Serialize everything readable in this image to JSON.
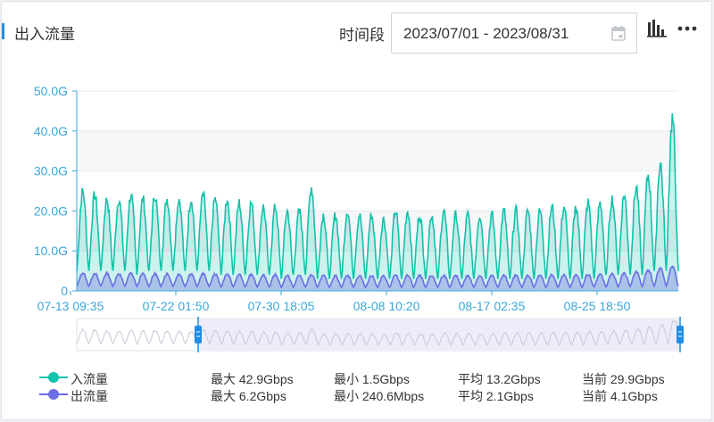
{
  "header": {
    "title": "出入流量",
    "range_label": "时间段",
    "date_range": "2023/07/01 - 2023/08/31"
  },
  "icons": {
    "calendar": "calendar-icon",
    "chart_toggle": "bar-chart-icon",
    "more": "more-dots-icon"
  },
  "colors": {
    "accent": "#1e8ee6",
    "inbound": "#12c2aa",
    "outbound": "#6c6de4",
    "axis": "#3ba7d9",
    "slider_handle": "#1e8ee6"
  },
  "chart_data": {
    "type": "area",
    "y_unit": "Gbps",
    "ylim": [
      0,
      50
    ],
    "y_ticks": [
      "0",
      "10.0G",
      "20.0G",
      "30.0G",
      "40.0G",
      "50.0G"
    ],
    "x_tick_labels": [
      "07-13 09:35",
      "07-22 01:50",
      "07-30 18:05",
      "08-08 10:20",
      "08-17 02:35",
      "08-25 18:50"
    ],
    "grid": true,
    "x_start": "07-13 00:00",
    "x_end": "08-31 24:00",
    "daily": {
      "dates": [
        "07-13",
        "07-14",
        "07-15",
        "07-16",
        "07-17",
        "07-18",
        "07-19",
        "07-20",
        "07-21",
        "07-22",
        "07-23",
        "07-24",
        "07-25",
        "07-26",
        "07-27",
        "07-28",
        "07-29",
        "07-30",
        "07-31",
        "08-01",
        "08-02",
        "08-03",
        "08-04",
        "08-05",
        "08-06",
        "08-07",
        "08-08",
        "08-09",
        "08-10",
        "08-11",
        "08-12",
        "08-13",
        "08-14",
        "08-15",
        "08-16",
        "08-17",
        "08-18",
        "08-19",
        "08-20",
        "08-21",
        "08-22",
        "08-23",
        "08-24",
        "08-25",
        "08-26",
        "08-27",
        "08-28",
        "08-29",
        "08-30",
        "08-31"
      ],
      "in_peak": [
        25,
        24,
        23,
        23,
        24,
        23,
        24,
        23,
        23,
        23,
        24,
        23,
        23,
        22,
        22,
        21,
        21,
        20,
        20,
        26,
        19,
        19,
        20,
        19,
        19,
        18,
        20,
        20,
        19,
        19,
        20,
        19,
        19,
        19,
        19,
        20,
        20,
        20,
        20,
        21,
        21,
        21,
        22,
        22,
        23,
        24,
        26,
        29,
        32,
        43
      ],
      "in_low": [
        5,
        5,
        5,
        5,
        5,
        4,
        5,
        5,
        5,
        5,
        5,
        5,
        4,
        4,
        4,
        4,
        4,
        3,
        4,
        4,
        3,
        3,
        3,
        3,
        3,
        3,
        3,
        3,
        3,
        3,
        3,
        3,
        3,
        3,
        3,
        3,
        3,
        3,
        3,
        3,
        3,
        3,
        3,
        3,
        4,
        4,
        4,
        4,
        5,
        5
      ],
      "out_peak": [
        4.5,
        4.4,
        4.4,
        4.3,
        4.4,
        4.3,
        4.3,
        4.3,
        4.2,
        4.3,
        4.3,
        4.2,
        4.2,
        4.1,
        4.1,
        4.0,
        4.0,
        3.9,
        3.9,
        4.0,
        3.8,
        3.8,
        3.9,
        3.8,
        3.8,
        3.7,
        3.9,
        3.9,
        3.8,
        3.8,
        3.9,
        3.8,
        3.8,
        3.8,
        3.8,
        3.9,
        3.9,
        3.9,
        3.9,
        4.0,
        4.0,
        4.0,
        4.1,
        4.1,
        4.3,
        4.5,
        4.8,
        5.3,
        5.8,
        6.2
      ],
      "out_low": [
        1.2,
        1.2,
        1.2,
        1.1,
        1.2,
        1.1,
        1.1,
        1.1,
        1.1,
        1.1,
        1.1,
        1.1,
        1.0,
        1.0,
        1.0,
        1.0,
        1.0,
        0.9,
        0.9,
        1.0,
        0.9,
        0.9,
        0.9,
        0.9,
        0.9,
        0.9,
        0.9,
        0.9,
        0.9,
        0.9,
        0.9,
        0.9,
        0.9,
        0.9,
        0.9,
        0.9,
        0.9,
        0.9,
        0.9,
        0.9,
        0.9,
        0.9,
        0.9,
        1.0,
        1.0,
        1.0,
        1.1,
        1.1,
        1.2,
        1.2
      ]
    },
    "series": [
      {
        "name": "入流量",
        "max": "最大 42.9Gbps",
        "min": "最小 1.5Gbps",
        "avg": "平均 13.2Gbps",
        "current": "当前 29.9Gbps"
      },
      {
        "name": "出流量",
        "max": "最大 6.2Gbps",
        "min": "最小 240.6Mbps",
        "avg": "平均 2.1Gbps",
        "current": "当前 4.1Gbps"
      }
    ]
  }
}
